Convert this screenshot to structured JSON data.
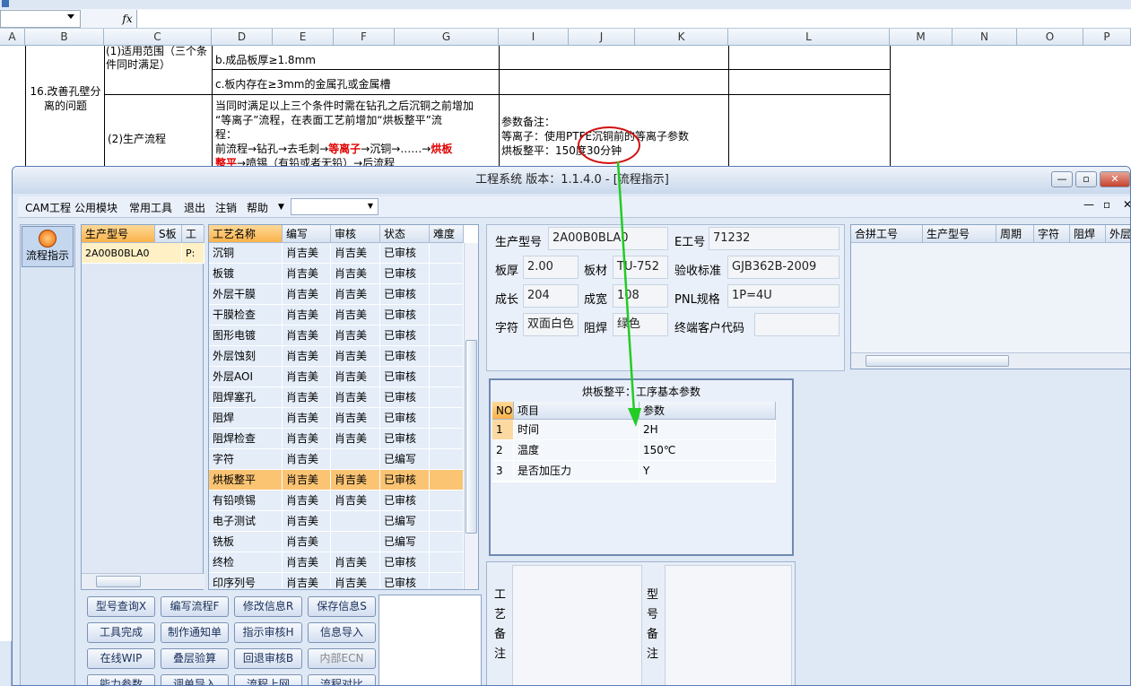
{
  "excel": {
    "column_headers": [
      "A",
      "B",
      "C",
      "D",
      "E",
      "F",
      "G",
      "I",
      "J",
      "K",
      "L",
      "M",
      "N",
      "O",
      "P"
    ],
    "fx": "fx",
    "b_cell": "16.改善孔壁分离的问题",
    "c1": "(1)适用范围（三个条件同时满足）",
    "d1": "b.成品板厚≥1.8mm",
    "d2": "c.板内存在≥3mm的金属孔或金属槽",
    "c2": "(2)生产流程",
    "d3_l1": "当同时满足以上三个条件时需在钻孔之后沉铜之前增加",
    "d3_l2": "“等离子”流程，在表面工艺前增加“烘板整平”流",
    "d3_l3": "程：",
    "d3_l4a": "前流程→钻孔→去毛刺→",
    "d3_l4b": "等离子",
    "d3_l4c": "→沉铜→……→",
    "d3_l4d": "烘板",
    "d3_l5a": "整平",
    "d3_l5b": "→喷锡（有铅或者无铅）→后流程",
    "i_l1": "参数备注：",
    "i_l2": "等离子：使用PTFE沉铜前的等离子参数",
    "i_l3": "烘板整平：150度30分钟"
  },
  "app": {
    "title": "工程系统  版本：1.1.4.0 - [流程指示]",
    "window_buttons": {
      "minimize": "—",
      "restore": "▫",
      "close": "✕"
    },
    "menu": [
      "CAM工程",
      "公用模块",
      "常用工具",
      "退出",
      "注销",
      "帮助"
    ],
    "mdi_buttons": [
      "—",
      "▫",
      "✕"
    ],
    "left_tool": "流程指示",
    "part_grid": {
      "headers": [
        "生产型号",
        "S板",
        "工"
      ],
      "rows": [
        [
          "2A00B0BLA0",
          "",
          "P:"
        ]
      ]
    },
    "process_grid": {
      "headers": [
        "工艺名称",
        "编写",
        "审核",
        "状态",
        "难度"
      ],
      "rows": [
        [
          "沉铜",
          "肖吉美",
          "肖吉美",
          "已审核"
        ],
        [
          "板镀",
          "肖吉美",
          "肖吉美",
          "已审核"
        ],
        [
          "外层干膜",
          "肖吉美",
          "肖吉美",
          "已审核"
        ],
        [
          "干膜检查",
          "肖吉美",
          "肖吉美",
          "已审核"
        ],
        [
          "图形电镀",
          "肖吉美",
          "肖吉美",
          "已审核"
        ],
        [
          "外层蚀刻",
          "肖吉美",
          "肖吉美",
          "已审核"
        ],
        [
          "外层AOI",
          "肖吉美",
          "肖吉美",
          "已审核"
        ],
        [
          "阻焊塞孔",
          "肖吉美",
          "肖吉美",
          "已审核"
        ],
        [
          "阻焊",
          "肖吉美",
          "肖吉美",
          "已审核"
        ],
        [
          "阻焊检查",
          "肖吉美",
          "肖吉美",
          "已审核"
        ],
        [
          "字符",
          "肖吉美",
          "",
          "已编写"
        ],
        [
          "烘板整平",
          "肖吉美",
          "肖吉美",
          "已审核"
        ],
        [
          "有铅喷锡",
          "肖吉美",
          "肖吉美",
          "已审核"
        ],
        [
          "电子测试",
          "肖吉美",
          "",
          "已编写"
        ],
        [
          "铣板",
          "肖吉美",
          "",
          "已编写"
        ],
        [
          "终检",
          "肖吉美",
          "肖吉美",
          "已审核"
        ],
        [
          "印序列号",
          "肖吉美",
          "肖吉美",
          "已审核"
        ]
      ],
      "selected": "烘板整平"
    },
    "buttons": [
      [
        "型号查询X",
        "编写流程F",
        "修改信息R",
        "保存信息S"
      ],
      [
        "工具完成",
        "制作通知单",
        "指示审核H",
        "信息导入"
      ],
      [
        "在线WIP",
        "叠层验算",
        "回退审核B",
        "内部ECN"
      ],
      [
        "能力参数",
        "调单导入",
        "流程上网",
        "流程对比"
      ]
    ],
    "info": {
      "model_label": "生产型号",
      "model": "2A00B0BLA0",
      "e_label": "E工号",
      "e": "71232",
      "thick_label": "板厚",
      "thick": "2.00",
      "mat_label": "板材",
      "mat": "TU-752",
      "std_label": "验收标准",
      "std": "GJB362B-2009",
      "len_label": "成长",
      "len": "204",
      "wid_label": "成宽",
      "wid": "108",
      "pnl_label": "PNL规格",
      "pnl": "1P=4U",
      "char_label": "字符",
      "char": "双面白色",
      "mask_label": "阻焊",
      "mask": "绿色",
      "cust_label": "终端客户代码",
      "cust": ""
    },
    "combo_grid": {
      "headers": [
        "合拼工号",
        "生产型号",
        "周期",
        "字符",
        "阻焊",
        "外层"
      ]
    },
    "params": {
      "title": "烘板整平：工序基本参数",
      "headers": [
        "NO",
        "项目",
        "参数"
      ],
      "rows": [
        [
          "1",
          "时间",
          "2H"
        ],
        [
          "2",
          "温度",
          "150℃"
        ],
        [
          "3",
          "是否加压力",
          "Y"
        ]
      ]
    },
    "remark1": "工艺备注",
    "remark2": "型号备注"
  },
  "colors": {
    "highlight_red": "#e00000",
    "arrow": "#22cc22",
    "selected_row": "#fbc473"
  }
}
